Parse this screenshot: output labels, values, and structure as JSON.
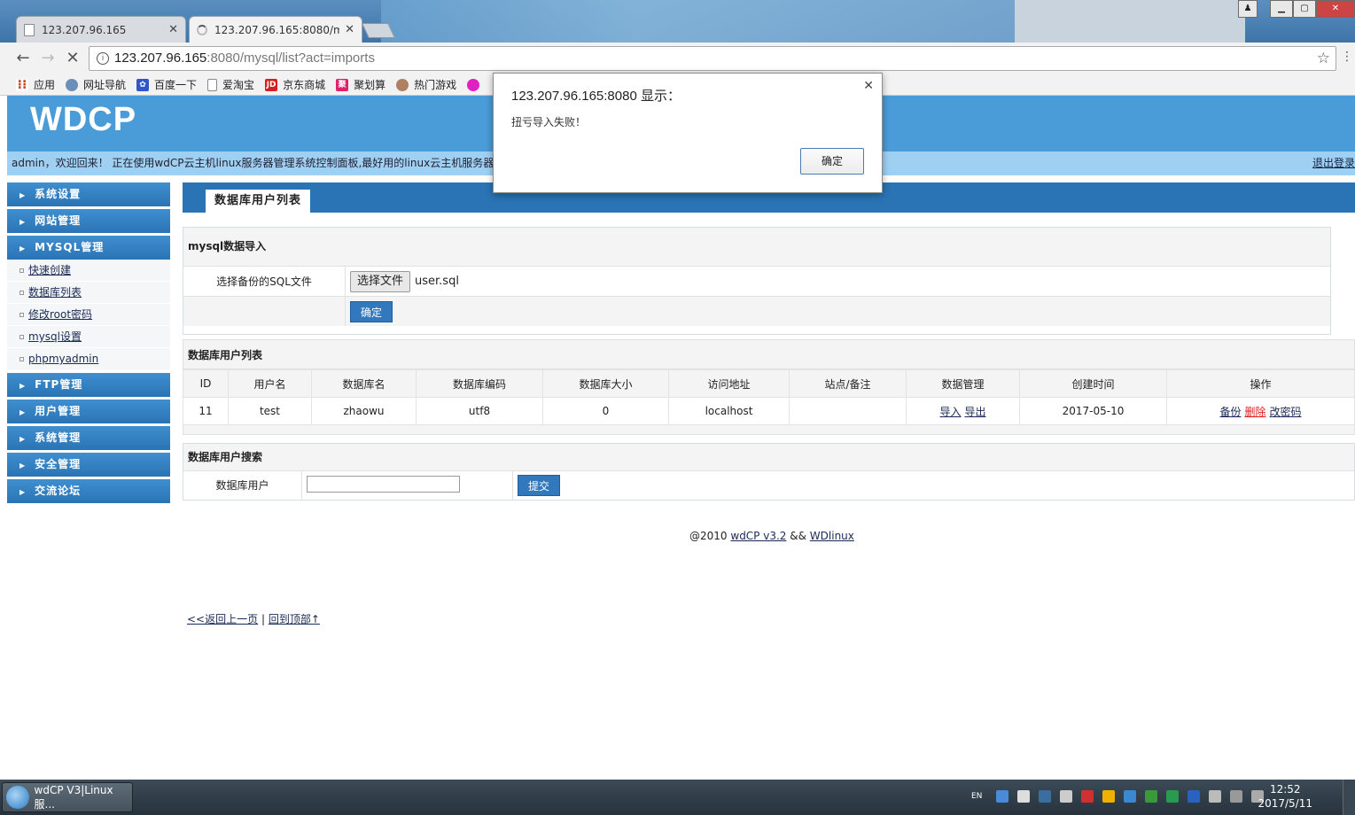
{
  "browser": {
    "tabs": [
      {
        "label": "123.207.96.165",
        "active": false
      },
      {
        "label": "123.207.96.165:8080/m",
        "active": true
      }
    ],
    "address": {
      "host": "123.207.96.165",
      "rest": ":8080/mysql/list?act=imports"
    },
    "bookmarks": [
      {
        "label": "应用",
        "icon": "apps-grid-icon",
        "color": "#d04020"
      },
      {
        "label": "网址导航",
        "icon": "globe-icon",
        "color": "#6a8fb8"
      },
      {
        "label": "百度一下",
        "icon": "paw-icon",
        "color": "#2f55c8"
      },
      {
        "label": "爱淘宝",
        "icon": "page-icon",
        "color": "#ffffff"
      },
      {
        "label": "京东商城",
        "icon": "jd-icon",
        "color": "#d62020"
      },
      {
        "label": "聚划算",
        "icon": "juhuasuan-icon",
        "color": "#e0206a"
      },
      {
        "label": "热门游戏",
        "icon": "game-avatar-icon",
        "color": "#b08060"
      }
    ]
  },
  "site": {
    "logo": "WDCP",
    "welcome": "admin，欢迎回来！ 正在使用wdCP云主机linux服务器管理系统控制面板,最好用的linux云主机服务器管理系统控制面板",
    "logout": "退出登录"
  },
  "sidebar": {
    "sections": [
      {
        "label": "系统设置"
      },
      {
        "label": "网站管理"
      },
      {
        "label": "MYSQL管理"
      }
    ],
    "mysql_items": [
      {
        "label": "快速创建"
      },
      {
        "label": "数据库列表"
      },
      {
        "label": "修改root密码"
      },
      {
        "label": "mysql设置"
      },
      {
        "label": "phpmyadmin"
      }
    ],
    "sections_after": [
      {
        "label": "FTP管理"
      },
      {
        "label": "用户管理"
      },
      {
        "label": "系统管理"
      },
      {
        "label": "安全管理"
      },
      {
        "label": "交流论坛"
      }
    ]
  },
  "content": {
    "page_tab": "数据库用户列表",
    "import": {
      "title": "mysql数据导入",
      "file_label": "选择备份的SQL文件",
      "choose_button": "选择文件",
      "file_name": "user.sql",
      "submit": "确定"
    },
    "table": {
      "title": "数据库用户列表",
      "columns": [
        "ID",
        "用户名",
        "数据库名",
        "数据库编码",
        "数据库大小",
        "访问地址",
        "站点/备注",
        "数据管理",
        "创建时间",
        "操作"
      ],
      "rows": [
        {
          "id": "11",
          "user": "test",
          "db": "zhaowu",
          "charset": "utf8",
          "size": "0",
          "host": "localhost",
          "note": "",
          "import": "导入",
          "export": "导出",
          "created": "2017-05-10",
          "backup": "备份",
          "delete": "删除",
          "chpass": "改密码"
        }
      ]
    },
    "search": {
      "title": "数据库用户搜索",
      "label": "数据库用户",
      "value": "",
      "submit": "提交"
    },
    "footer": {
      "back": "<<返回上一页",
      "sep": "|",
      "top": "回到顶部↑",
      "copy_prefix": "@2010",
      "product": "wdCP v3.2",
      "and": "&&",
      "vendor": "WDlinux"
    }
  },
  "dialog": {
    "title": "123.207.96.165:8080 显示：",
    "message": "扭亏导入失败！",
    "ok": "确定"
  },
  "taskbar": {
    "app_label": "wdCP V3|Linux服...",
    "lang": "EN",
    "time": "12:52",
    "date": "2017/5/11"
  }
}
